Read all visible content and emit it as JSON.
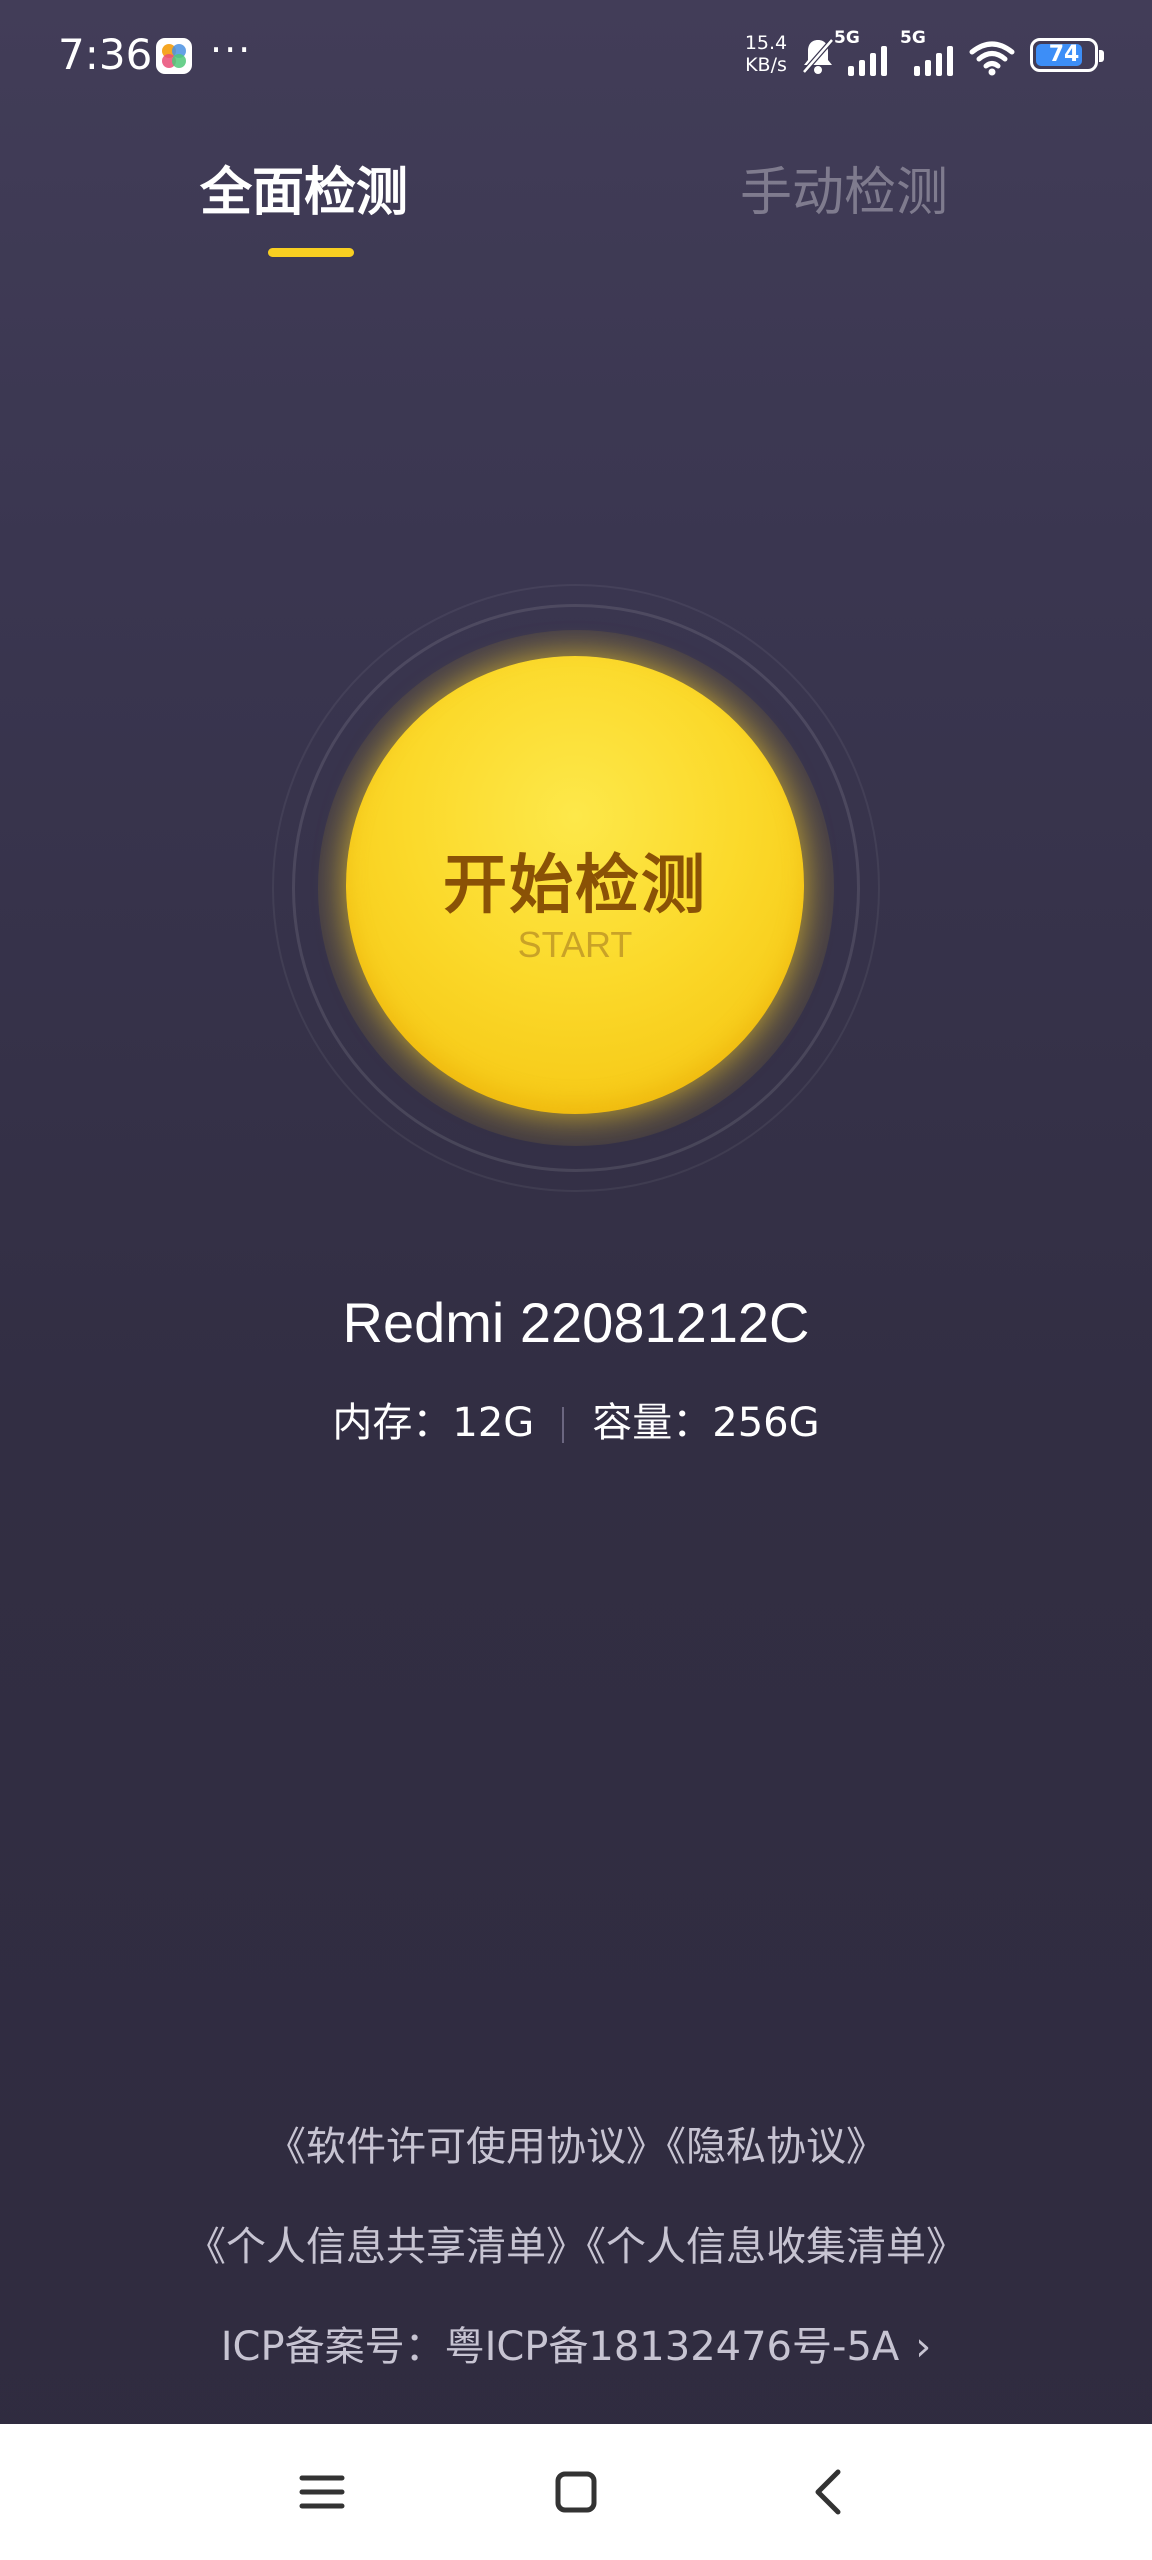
{
  "status_bar": {
    "time": "7:36",
    "more": "···",
    "net_speed_value": "15.4",
    "net_speed_unit": "KB/s",
    "signal_label_1": "5G",
    "signal_label_2": "5G",
    "battery": "74",
    "icons": [
      "app-icon",
      "mute-bell-icon",
      "signal-icon",
      "signal-icon",
      "wifi-icon",
      "battery-icon"
    ]
  },
  "tabs": [
    {
      "label": "全面检测",
      "active": true
    },
    {
      "label": "手动检测",
      "active": false
    }
  ],
  "start_button": {
    "label": "开始检测",
    "sublabel": "START"
  },
  "device": {
    "model": "Redmi 22081212C",
    "memory": "内存：12G",
    "storage": "容量：256G"
  },
  "footer": {
    "license_link": "《软件许可使用协议》",
    "privacy_link": "《隐私协议》",
    "share_list_link": "《个人信息共享清单》",
    "collect_list_link": "《个人信息收集清单》",
    "icp": "ICP备案号：粤ICP备18132476号-5A",
    "icp_chevron": "›"
  },
  "nav_bar": {
    "icons": [
      "menu-icon",
      "home-icon",
      "back-icon"
    ]
  },
  "colors": {
    "accent": "#f8cf21",
    "background_top": "#423d58",
    "background_bottom": "#2f2b3f",
    "button_text": "#8a5206"
  }
}
